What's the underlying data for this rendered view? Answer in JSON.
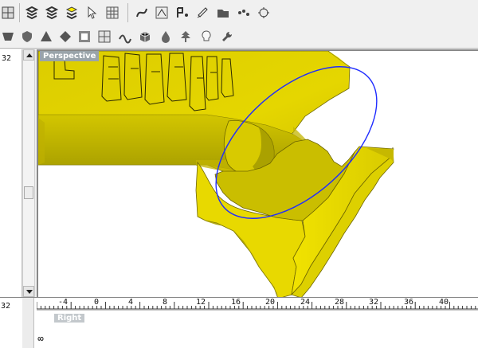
{
  "colors": {
    "toolbar_bg": "#f0f0f0",
    "viewport_bg": "#ffffff",
    "model_fill": "#e3d700",
    "model_shadow": "#a7a000",
    "model_outline": "#5b5600",
    "blue_curve": "#1f2cff"
  },
  "icons": {
    "toolbar_row_1": [
      "grid-icon",
      "layer-stack-icon",
      "layer-stack-icon",
      "layer-stack-active-icon",
      "select-cursor-icon",
      "grid-dot-icon",
      "curve-icon",
      "network-icon",
      "point-icon",
      "brush-icon",
      "folder-icon",
      "dots-icon",
      "settings-icon"
    ],
    "toolbar_row_2": [
      "shape-icon",
      "shield-icon",
      "triangle-icon",
      "diamond-icon",
      "panel-icon",
      "grid-icon",
      "wave-icon",
      "cube-icon",
      "drop-icon",
      "tree-icon",
      "bulb-icon",
      "wrench-icon"
    ]
  },
  "viewport": {
    "perspective_label": "Perspective",
    "right_label": "Right"
  },
  "rulers": {
    "left_numbers": [
      "32"
    ],
    "top_numbers": [
      "-4",
      "0",
      "4",
      "8",
      "12",
      "16",
      "20",
      "24",
      "28",
      "32",
      "36",
      "40"
    ],
    "bottom_left_numbers": [
      "8"
    ]
  }
}
